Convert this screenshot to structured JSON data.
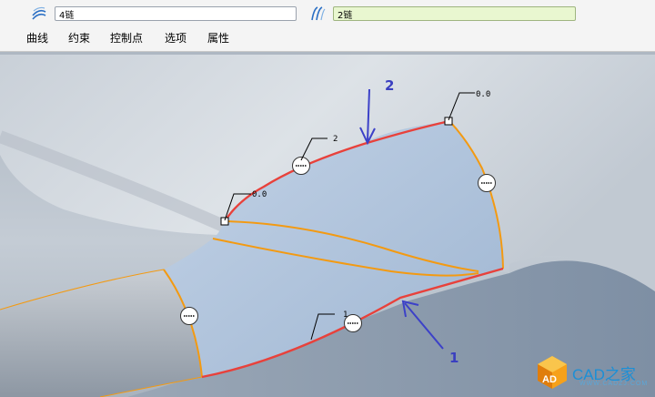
{
  "toolbar": {
    "chain_1": {
      "icon": "chain-curve-icon",
      "value": "4链"
    },
    "chain_2": {
      "icon": "chain-curve-icon",
      "value": "2链"
    },
    "tabs": [
      "曲线",
      "约束",
      "控制点",
      "选项",
      "属性"
    ]
  },
  "viewport": {
    "vertex_labels": [
      "0.0",
      "0.0",
      "2",
      "1"
    ],
    "callouts": [
      "2",
      "1"
    ],
    "colors": {
      "boundary_red": "#e8413b",
      "boundary_orange": "#f39a12",
      "arrow_blue": "#3c41c8"
    }
  },
  "watermark": {
    "text": "CAD之家",
    "url": "WWW.CADZJ.COM",
    "logo_letters": "AD"
  }
}
